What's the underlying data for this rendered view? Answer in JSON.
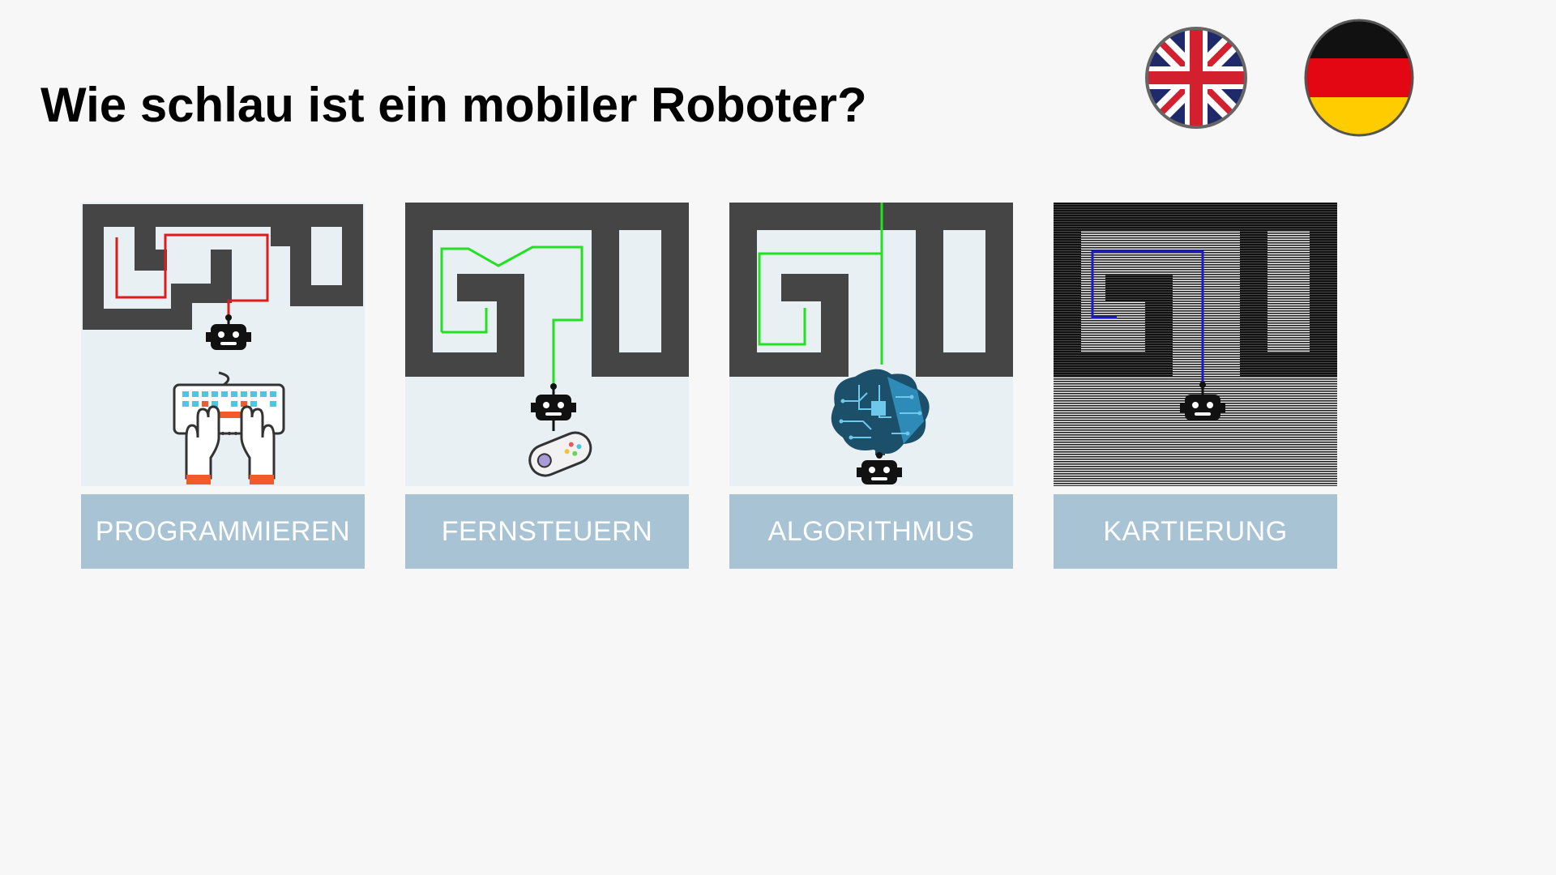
{
  "page": {
    "title": "Wie schlau ist ein mobiler Roboter?"
  },
  "language_switch": [
    {
      "name": "english-flag-icon",
      "lang": "en"
    },
    {
      "name": "german-flag-icon",
      "lang": "de"
    }
  ],
  "cards": [
    {
      "label": "PROGRAMMIEREN",
      "path_color": "#e01b1b",
      "icon": "keyboard-hands-icon"
    },
    {
      "label": "FERNSTEUERN",
      "path_color": "#22e022",
      "icon": "gamepad-icon"
    },
    {
      "label": "ALGORITHMUS",
      "path_color": "#22e022",
      "icon": "circuit-brain-icon"
    },
    {
      "label": "KARTIERUNG",
      "path_color": "#1a1ad0",
      "icon": "scanlines-map-icon"
    }
  ],
  "colors": {
    "background": "#f7f7f7",
    "label_bg": "#a7c3d4",
    "maze_wall": "#454545",
    "art_bg": "#e9f0f3"
  }
}
